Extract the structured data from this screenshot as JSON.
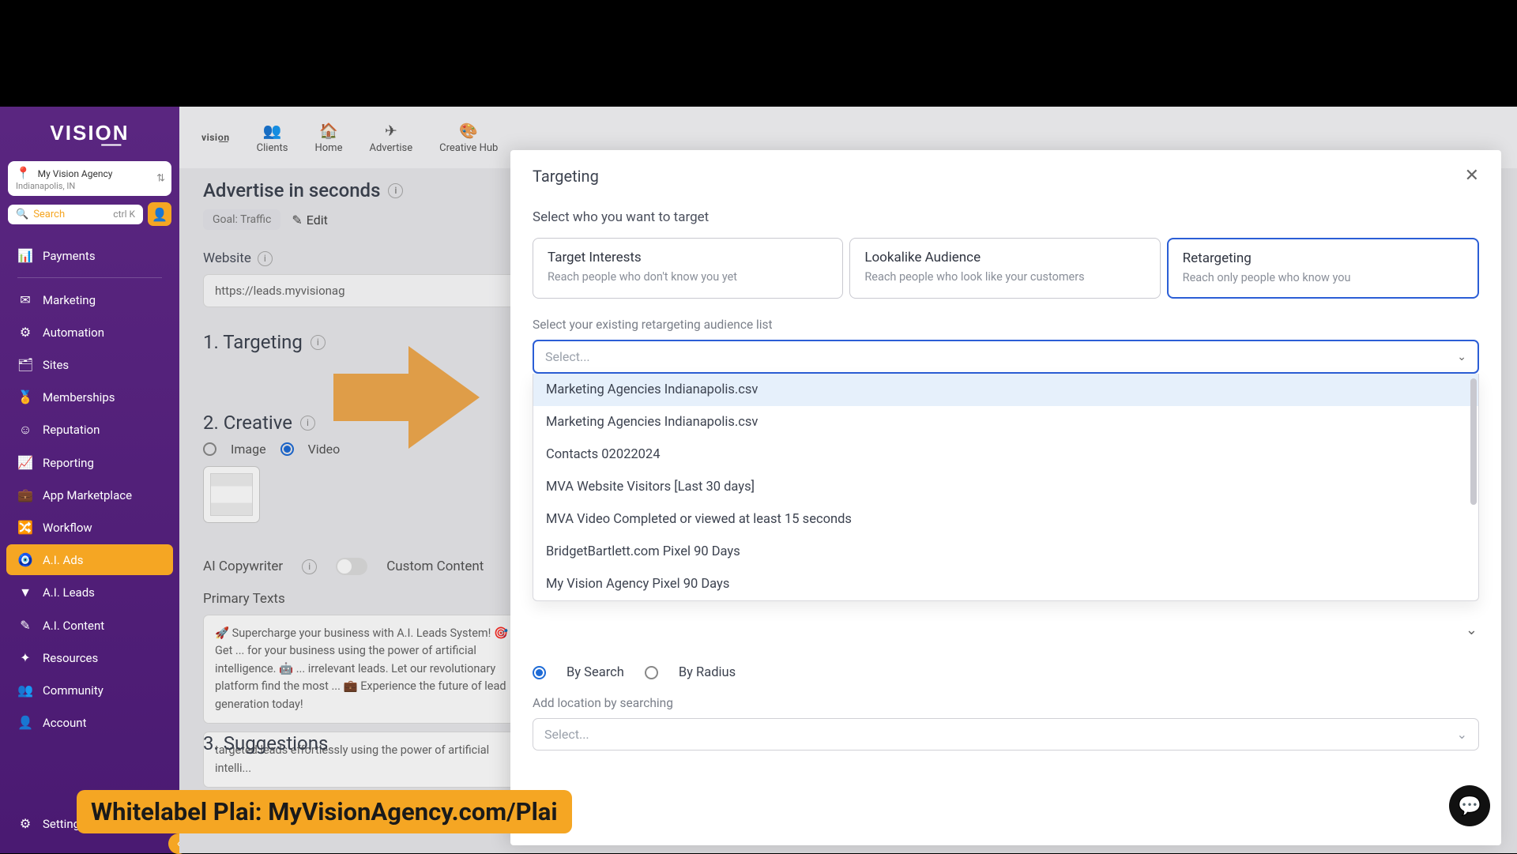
{
  "brand": "VISIO͟N",
  "agency": {
    "name": "My Vision Agency",
    "location": "Indianapolis, IN"
  },
  "search": {
    "placeholder": "Search",
    "shortcut": "ctrl K"
  },
  "nav": {
    "payments": "Payments",
    "marketing": "Marketing",
    "automation": "Automation",
    "sites": "Sites",
    "memberships": "Memberships",
    "reputation": "Reputation",
    "reporting": "Reporting",
    "app_marketplace": "App Marketplace",
    "workflow": "Workflow",
    "ai_ads": "A.I. Ads",
    "ai_leads": "A.I. Leads",
    "ai_content": "A.I. Content",
    "resources": "Resources",
    "community": "Community",
    "account": "Account",
    "settings": "Settings"
  },
  "topnav": {
    "brand": "visio͟n",
    "clients": "Clients",
    "home": "Home",
    "advertise": "Advertise",
    "creative_hub": "Creative Hub"
  },
  "page": {
    "title": "Advertise in seconds",
    "goal_chip": "Goal: Traffic",
    "edit": "Edit",
    "website_label": "Website",
    "website_value": "https://leads.myvisionag",
    "step1": "1.  Targeting",
    "step2": "2. Creative",
    "step3": "3. Suggestions",
    "radio_image": "Image",
    "radio_video": "Video",
    "ai_copy": "AI Copywriter",
    "custom_content": "Custom Content",
    "primary_texts": "Primary Texts",
    "primary_body": "🚀 Supercharge your business with A.I. Leads System! 🎯 Get ... for your business using the power of artificial intelligence. 🤖 ... irrelevant leads. Let our revolutionary platform find the most ... 💼 Experience the future of lead generation today!",
    "primary_body2": "targeted leads effortlessly using the power of artificial intelli..."
  },
  "modal": {
    "title": "Targeting",
    "instruction": "Select who you want to target",
    "cards": {
      "interests": {
        "title": "Target Interests",
        "desc": "Reach people who don't know you yet"
      },
      "lookalike": {
        "title": "Lookalike Audience",
        "desc": "Reach people who look like your customers"
      },
      "retarget": {
        "title": "Retargeting",
        "desc": "Reach only people who know you"
      }
    },
    "audience_label": "Select your existing retargeting audience list",
    "select_placeholder": "Select...",
    "options": [
      "Marketing Agencies Indianapolis.csv",
      "Marketing Agencies Indianapolis.csv",
      "Contacts 02022024",
      "MVA Website Visitors [Last 30 days]",
      "MVA Video Completed or viewed at least 15 seconds",
      "BridgetBartlett.com Pixel 90 Days",
      "My Vision Agency Pixel 90 Days"
    ],
    "by_search": "By Search",
    "by_radius": "By Radius",
    "location_label": "Add location by searching",
    "location_placeholder": "Select..."
  },
  "banner": "Whitelabel Plai: MyVisionAgency.com/Plai"
}
